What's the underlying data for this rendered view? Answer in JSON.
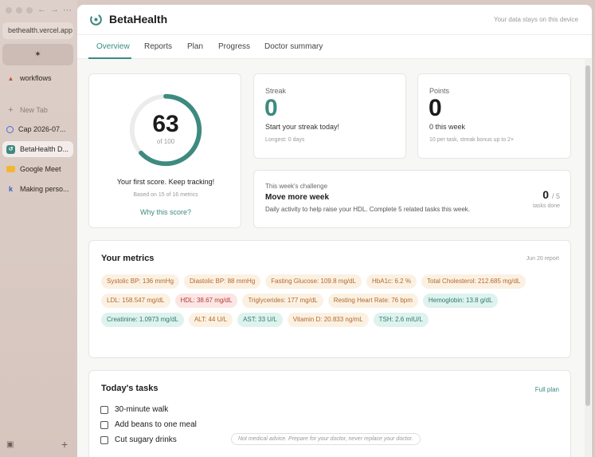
{
  "browser": {
    "url": "bethealth.vercel.app",
    "pinned_icon": "spark-icon",
    "items": [
      {
        "label": "workflows",
        "icon": "bird-icon"
      },
      {
        "label": "New Tab",
        "icon": "plus-icon"
      },
      {
        "label": "Cap 2026-07...",
        "icon": "cap-icon"
      },
      {
        "label": "BetaHealth D...",
        "icon": "betahealth-icon"
      },
      {
        "label": "Google Meet",
        "icon": "meet-icon"
      },
      {
        "label": "Making perso...",
        "icon": "k-icon"
      }
    ]
  },
  "header": {
    "brand": "BetaHealth",
    "privacy_note": "Your data stays on this device"
  },
  "tabs": [
    {
      "label": "Overview",
      "active": true
    },
    {
      "label": "Reports"
    },
    {
      "label": "Plan"
    },
    {
      "label": "Progress"
    },
    {
      "label": "Doctor summary"
    }
  ],
  "score": {
    "value": "63",
    "out_of": "of 100",
    "message": "Your first score. Keep tracking!",
    "based_on": "Based on 15 of 16 metrics",
    "link": "Why this score?",
    "fraction": 0.63
  },
  "streak": {
    "label": "Streak",
    "value": "0",
    "desc": "Start your streak today!",
    "foot": "Longest: 0 days"
  },
  "points": {
    "label": "Points",
    "value": "0",
    "desc": "0 this week",
    "foot": "10 per task, streak bonus up to 2×"
  },
  "challenge": {
    "label": "This week's challenge",
    "title": "Move more week",
    "desc": "Daily activity to help raise your HDL. Complete 5 related tasks this week.",
    "count": "0",
    "total": "/ 5",
    "foot": "tasks done"
  },
  "metrics": {
    "title": "Your metrics",
    "date": "Jun 20 report",
    "items": [
      {
        "label": "Systolic BP: 136 mmHg",
        "status": "warn"
      },
      {
        "label": "Diastolic BP: 88 mmHg",
        "status": "warn"
      },
      {
        "label": "Fasting Glucose: 109.8 mg/dL",
        "status": "warn"
      },
      {
        "label": "HbA1c: 6.2 %",
        "status": "warn"
      },
      {
        "label": "Total Cholesterol: 212.685 mg/dL",
        "status": "warn"
      },
      {
        "label": "LDL: 158.547 mg/dL",
        "status": "warn"
      },
      {
        "label": "HDL: 38.67 mg/dL",
        "status": "bad"
      },
      {
        "label": "Triglycerides: 177 mg/dL",
        "status": "warn"
      },
      {
        "label": "Resting Heart Rate: 76 bpm",
        "status": "warn"
      },
      {
        "label": "Hemoglobin: 13.8 g/dL",
        "status": "good"
      },
      {
        "label": "Creatinine: 1.0973 mg/dL",
        "status": "good"
      },
      {
        "label": "ALT: 44 U/L",
        "status": "warn"
      },
      {
        "label": "AST: 33 U/L",
        "status": "good"
      },
      {
        "label": "Vitamin D: 20.833 ng/mL",
        "status": "warn"
      },
      {
        "label": "TSH: 2.6 mIU/L",
        "status": "good"
      }
    ]
  },
  "tasks": {
    "title": "Today's tasks",
    "link": "Full plan",
    "items": [
      "30-minute walk",
      "Add beans to one meal",
      "Cut sugary drinks"
    ],
    "disclaimer": "Not medical advice. Prepare for your doctor, never replace your doctor."
  },
  "colors": {
    "accent": "#3d8a80",
    "warn": "#b4692a",
    "bad": "#b53a34",
    "good": "#2f7b70"
  }
}
